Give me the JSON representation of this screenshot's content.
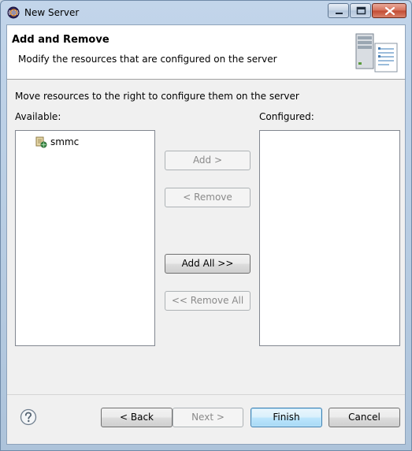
{
  "window": {
    "title": "New Server"
  },
  "header": {
    "title": "Add and Remove",
    "description": "Modify the resources that are configured on the server"
  },
  "main": {
    "instruction": "Move resources to the right to configure them on the server",
    "available_label": "Available:",
    "configured_label": "Configured:",
    "available_items": [
      "smmc"
    ],
    "configured_items": []
  },
  "actions": {
    "add": "Add >",
    "remove": "< Remove",
    "add_all": "Add All >>",
    "remove_all": "<< Remove All"
  },
  "footer": {
    "back": "< Back",
    "next": "Next >",
    "finish": "Finish",
    "cancel": "Cancel"
  },
  "colors": {
    "accent": "#3c7fb1",
    "disabled_text": "#8a8a8a"
  }
}
